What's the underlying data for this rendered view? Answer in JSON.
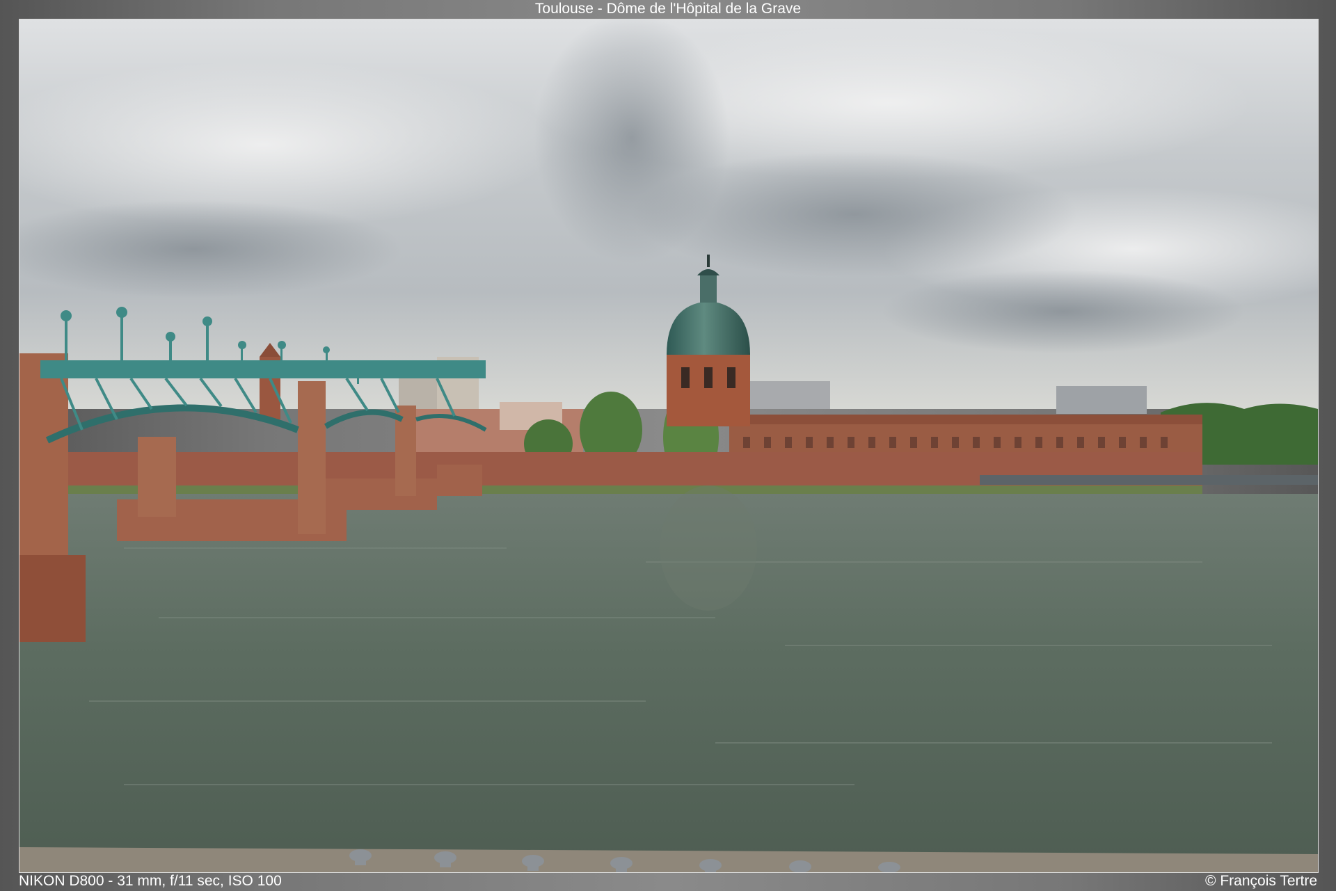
{
  "header": {
    "title": "Toulouse - Dôme de l'Hôpital de la Grave"
  },
  "photo": {
    "subject": "river-dome-bridge-landscape"
  },
  "footer": {
    "exif": "NIKON D800 - 31 mm, f/11 sec, ISO 100",
    "copyright": "© François Tertre"
  },
  "colors": {
    "sky": "#c9cdd0",
    "water": "#5f6e63",
    "brick": "#a85a3d",
    "dome": "#4f7a72",
    "bridge": "#3f8a86"
  }
}
